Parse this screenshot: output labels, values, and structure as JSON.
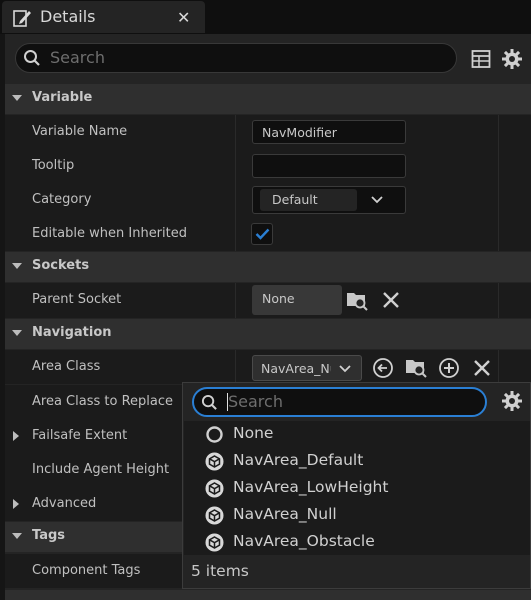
{
  "tab": {
    "title": "Details",
    "close": "✕"
  },
  "search": {
    "placeholder": "Search"
  },
  "categories": {
    "variable": "Variable",
    "sockets": "Sockets",
    "navigation": "Navigation",
    "tags": "Tags"
  },
  "properties": {
    "variable_name": {
      "label": "Variable Name",
      "value": "NavModifier"
    },
    "tooltip": {
      "label": "Tooltip",
      "value": ""
    },
    "category": {
      "label": "Category",
      "value": "Default"
    },
    "editable_when_inherited": {
      "label": "Editable when Inherited",
      "checked": true
    },
    "parent_socket": {
      "label": "Parent Socket",
      "value": "None"
    },
    "area_class": {
      "label": "Area Class",
      "value": "NavArea_Nu"
    },
    "area_class_to_replace": {
      "label": "Area Class to Replace"
    },
    "failsafe_extent": {
      "label": "Failsafe Extent"
    },
    "include_agent_height": {
      "label": "Include Agent Height"
    },
    "advanced": {
      "label": "Advanced"
    },
    "component_tags": {
      "label": "Component Tags"
    }
  },
  "picker": {
    "search_placeholder": "Search",
    "items": [
      {
        "label": "None",
        "icon": "none-circle-icon"
      },
      {
        "label": "NavArea_Default",
        "icon": "class-cube-icon"
      },
      {
        "label": "NavArea_LowHeight",
        "icon": "class-cube-icon"
      },
      {
        "label": "NavArea_Null",
        "icon": "class-cube-icon"
      },
      {
        "label": "NavArea_Obstacle",
        "icon": "class-cube-icon"
      }
    ],
    "footer": "5 items"
  },
  "colors": {
    "accent": "#2a7fd4",
    "panel": "#242424",
    "row": "#1b1b1b",
    "category": "#2f2f2f"
  }
}
